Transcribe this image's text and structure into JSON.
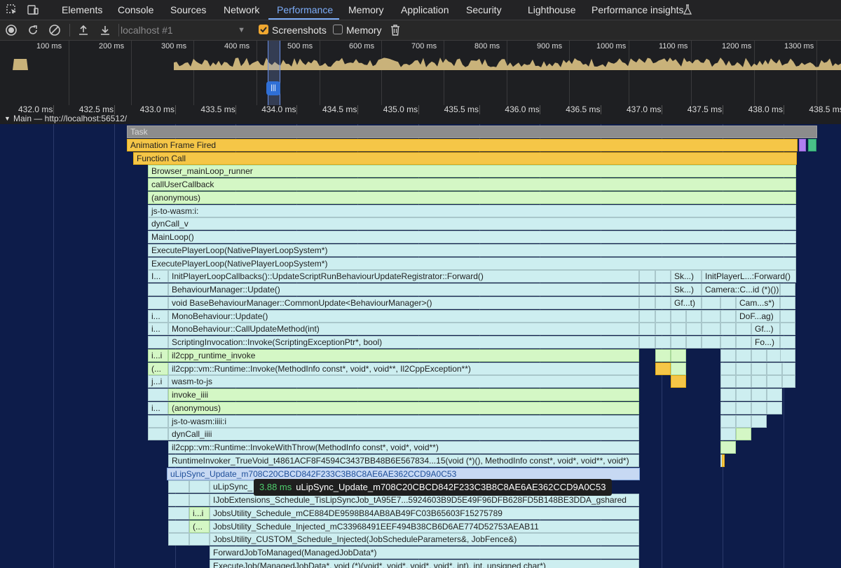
{
  "tabs": [
    {
      "label": "Elements"
    },
    {
      "label": "Console"
    },
    {
      "label": "Sources"
    },
    {
      "label": "Network"
    },
    {
      "label": "Performance",
      "active": true
    },
    {
      "label": "Memory"
    },
    {
      "label": "Application"
    },
    {
      "label": "Security"
    },
    {
      "label": "Lighthouse"
    },
    {
      "label": "Performance insights"
    }
  ],
  "toolbar": {
    "target": "localhost #1",
    "screenshots_label": "Screenshots",
    "screenshots_checked": true,
    "memory_label": "Memory",
    "memory_checked": false
  },
  "overview": {
    "ticks": [
      "100 ms",
      "200 ms",
      "300 ms",
      "400 ms",
      "500 ms",
      "600 ms",
      "700 ms",
      "800 ms",
      "900 ms",
      "1000 ms",
      "1100 ms",
      "1200 ms",
      "1300 ms"
    ],
    "colors": {
      "scripting": "#c9b27a",
      "idle": "#1e1f22",
      "selection": "#2f6fd6"
    }
  },
  "ruler": {
    "ticks": [
      "432.0 ms",
      "432.5 ms",
      "433.0 ms",
      "433.5 ms",
      "434.0 ms",
      "434.5 ms",
      "435.0 ms",
      "435.5 ms",
      "436.0 ms",
      "436.5 ms",
      "437.0 ms",
      "437.5 ms",
      "438.0 ms",
      "438.5 ms"
    ]
  },
  "track": {
    "title": "Main — http://localhost:56512/"
  },
  "flame_rows": [
    {
      "events": [
        {
          "label": "Task",
          "kind": "task"
        }
      ]
    },
    {
      "events": [
        {
          "label": "Animation Frame Fired",
          "kind": "yellow"
        },
        {
          "label": "",
          "kind": "purple"
        },
        {
          "label": "",
          "kind": "teal"
        }
      ]
    },
    {
      "events": [
        {
          "label": "Function Call",
          "kind": "yellow"
        }
      ]
    },
    {
      "events": [
        {
          "label": "Browser_mainLoop_runner",
          "kind": "green"
        }
      ]
    },
    {
      "events": [
        {
          "label": "callUserCallback",
          "kind": "green"
        }
      ]
    },
    {
      "events": [
        {
          "label": "(anonymous)",
          "kind": "green"
        }
      ]
    },
    {
      "events": [
        {
          "label": "js-to-wasm:i:",
          "kind": "blue"
        }
      ]
    },
    {
      "events": [
        {
          "label": "dynCall_v",
          "kind": "blue"
        }
      ]
    },
    {
      "events": [
        {
          "label": "MainLoop()",
          "kind": "blue"
        }
      ]
    },
    {
      "events": [
        {
          "label": "ExecutePlayerLoop(NativePlayerLoopSystem*)",
          "kind": "blue"
        }
      ]
    },
    {
      "events": [
        {
          "label": "ExecutePlayerLoop(NativePlayerLoopSystem*)",
          "kind": "blue"
        }
      ]
    },
    {
      "events": [
        {
          "label": "I...",
          "kind": "blue"
        },
        {
          "label": "InitPlayerLoopCallbacks()::UpdateScriptRunBehaviourUpdateRegistrator::Forward()",
          "kind": "blue"
        },
        {
          "label": "Sk...)",
          "kind": "blue"
        },
        {
          "label": "InitPlayerL...:Forward()",
          "kind": "blue"
        }
      ]
    },
    {
      "events": [
        {
          "label": "BehaviourManager::Update()",
          "kind": "blue"
        },
        {
          "label": "Sk...)",
          "kind": "blue"
        },
        {
          "label": "Camera::C...id (*)())",
          "kind": "blue"
        }
      ]
    },
    {
      "events": [
        {
          "label": "void BaseBehaviourManager::CommonUpdate<BehaviourManager>()",
          "kind": "blue"
        },
        {
          "label": "Gf...t)",
          "kind": "blue"
        },
        {
          "label": "Cam...s*)",
          "kind": "blue"
        }
      ]
    },
    {
      "events": [
        {
          "label": "i...",
          "kind": "blue"
        },
        {
          "label": "MonoBehaviour::Update()",
          "kind": "blue"
        },
        {
          "label": "DoF...ag)",
          "kind": "blue"
        }
      ]
    },
    {
      "events": [
        {
          "label": "i...",
          "kind": "blue"
        },
        {
          "label": "MonoBehaviour::CallUpdateMethod(int)",
          "kind": "blue"
        },
        {
          "label": "Gf...)",
          "kind": "blue"
        }
      ]
    },
    {
      "events": [
        {
          "label": "ScriptingInvocation::Invoke(ScriptingExceptionPtr*, bool)",
          "kind": "blue"
        },
        {
          "label": "Fo...)",
          "kind": "blue"
        }
      ]
    },
    {
      "events": [
        {
          "label": "i...i",
          "kind": "green"
        },
        {
          "label": "il2cpp_runtime_invoke",
          "kind": "green"
        }
      ]
    },
    {
      "events": [
        {
          "label": "(...",
          "kind": "green"
        },
        {
          "label": "il2cpp::vm::Runtime::Invoke(MethodInfo const*, void*, void**, Il2CppException**)",
          "kind": "blue"
        }
      ]
    },
    {
      "events": [
        {
          "label": "j...i",
          "kind": "blue"
        },
        {
          "label": "wasm-to-js",
          "kind": "blue"
        }
      ]
    },
    {
      "events": [
        {
          "label": "invoke_iiii",
          "kind": "green"
        }
      ]
    },
    {
      "events": [
        {
          "label": "i...",
          "kind": "blue"
        },
        {
          "label": "(anonymous)",
          "kind": "green"
        }
      ]
    },
    {
      "events": [
        {
          "label": "js-to-wasm:iiii:i",
          "kind": "blue"
        }
      ]
    },
    {
      "events": [
        {
          "label": "dynCall_iiii",
          "kind": "blue"
        }
      ]
    },
    {
      "events": [
        {
          "label": "il2cpp::vm::Runtime::InvokeWithThrow(MethodInfo const*, void*, void**)",
          "kind": "blue"
        }
      ]
    },
    {
      "events": [
        {
          "label": "RuntimeInvoker_TrueVoid_t4861ACF8F4594C3437BB48B6E567834...15(void (*)(), MethodInfo const*, void*, void**, void*)",
          "kind": "blue"
        }
      ]
    },
    {
      "events": [
        {
          "label": "uLipSync_Update_m708C20CBCD842F233C3B8C8AE6AE362CCD9A0C53",
          "kind": "selected"
        }
      ]
    },
    {
      "events": [
        {
          "label": "uLipSync_",
          "kind": "blue"
        }
      ]
    },
    {
      "events": [
        {
          "label": "IJobExtensions_Schedule_TisLipSyncJob_tA95E7...5924603B9D5E49F96DFB628FD5B148BE3DDA_gshared",
          "kind": "blue"
        }
      ]
    },
    {
      "events": [
        {
          "label": "i...i",
          "kind": "green"
        },
        {
          "label": "JobsUtility_Schedule_mCE884DE9598B84AB8AB49FC03B65603F15275789",
          "kind": "blue"
        }
      ]
    },
    {
      "events": [
        {
          "label": "(...",
          "kind": "green"
        },
        {
          "label": "JobsUtility_Schedule_Injected_mC33968491EEF494B38CB6D6AE774D52753AEAB11",
          "kind": "blue"
        }
      ]
    },
    {
      "events": [
        {
          "label": "JobsUtility_CUSTOM_Schedule_Injected(JobScheduleParameters&, JobFence&)",
          "kind": "blue"
        }
      ]
    },
    {
      "events": [
        {
          "label": "ForwardJobToManaged(ManagedJobData*)",
          "kind": "blue"
        }
      ]
    },
    {
      "events": [
        {
          "label": "ExecuteJob(ManagedJobData*, void (*)(void*, void*, void*, void*, int), int, unsigned char*)",
          "kind": "blue"
        }
      ]
    }
  ],
  "tooltip": {
    "duration": "3.88 ms",
    "name": "uLipSync_Update_m708C20CBCD842F233C3B8C8AE6AE362CCD9A0C53"
  }
}
